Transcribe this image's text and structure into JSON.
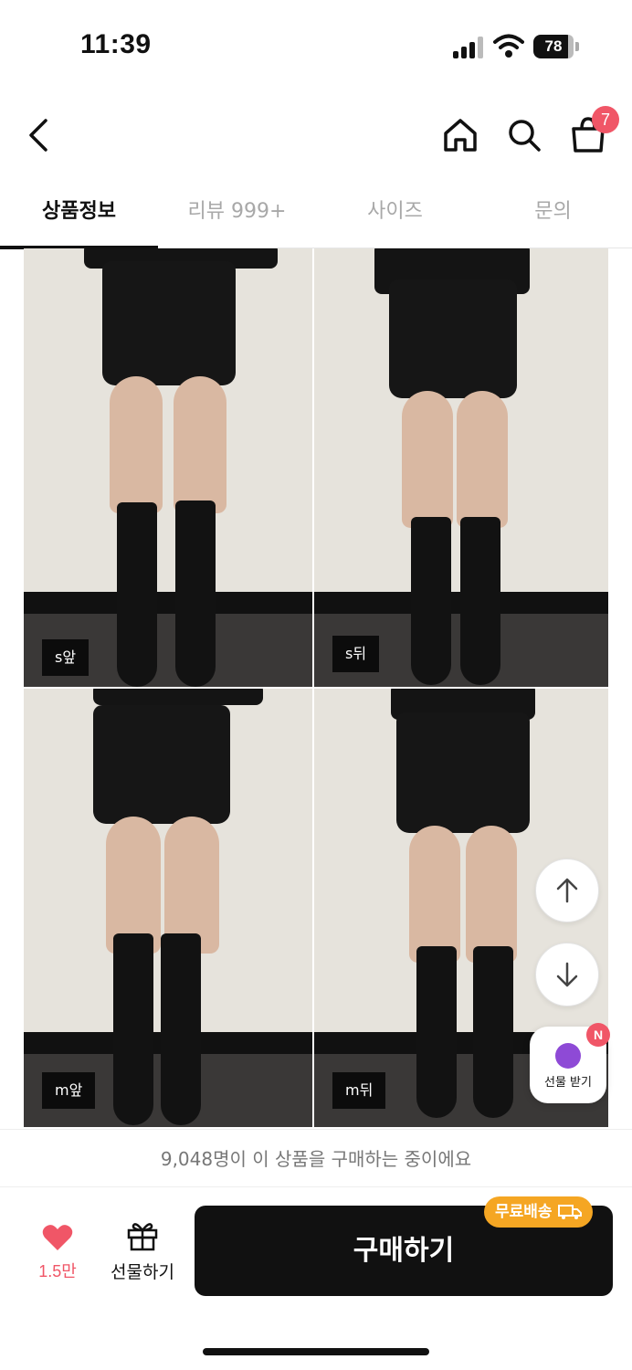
{
  "status_bar": {
    "time": "11:39",
    "battery": "78"
  },
  "header": {
    "cart_count": "7"
  },
  "tabs": [
    {
      "label": "상품정보",
      "active": true
    },
    {
      "label": "리뷰 999+",
      "active": false
    },
    {
      "label": "사이즈",
      "active": false
    },
    {
      "label": "문의",
      "active": false
    }
  ],
  "photos": [
    {
      "label": "s앞"
    },
    {
      "label": "s뒤"
    },
    {
      "label": "m앞"
    },
    {
      "label": "m뒤"
    }
  ],
  "floating": {
    "gift_receive_label": "선물 받기",
    "new_badge": "N"
  },
  "notice": "9,048명이 이 상품을 구매하는 중이에요",
  "bottom_bar": {
    "like_count": "1.5만",
    "gift_label": "선물하기",
    "buy_label": "구매하기",
    "free_shipping": "무료배송"
  },
  "colors": {
    "accent": "#f05667",
    "shipping": "#f5a623",
    "buy_button": "#111111"
  },
  "icons": [
    "back-arrow-icon",
    "home-icon",
    "search-icon",
    "shopping-bag-icon",
    "arrow-up-icon",
    "arrow-down-icon",
    "heart-icon",
    "gift-icon",
    "truck-icon"
  ]
}
